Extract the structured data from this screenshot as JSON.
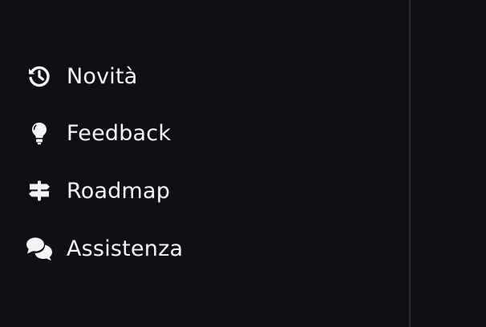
{
  "menu": {
    "items": [
      {
        "label": "Novità",
        "icon": "history-icon"
      },
      {
        "label": "Feedback",
        "icon": "lightbulb-icon"
      },
      {
        "label": "Roadmap",
        "icon": "signpost-icon"
      },
      {
        "label": "Assistenza",
        "icon": "chat-bubbles-icon"
      }
    ]
  },
  "colors": {
    "background": "#0f1015",
    "text": "#f4f4f6",
    "divider": "#2b2c32"
  }
}
